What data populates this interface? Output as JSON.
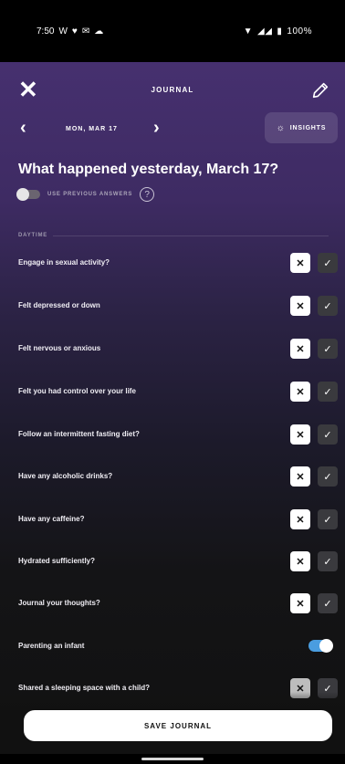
{
  "status_bar": {
    "time": "7:50",
    "left_icons": [
      "w-icon",
      "notification-icon",
      "mail-icon",
      "cloud-icon"
    ],
    "battery": "100%"
  },
  "header": {
    "title": "JOURNAL",
    "date": "MON, MAR 17",
    "insights_label": "INSIGHTS"
  },
  "main": {
    "headline": "What happened yesterday, March 17?",
    "use_previous_label": "USE PREVIOUS ANSWERS",
    "help_symbol": "?",
    "section_label": "DAYTIME",
    "questions": [
      {
        "text": "Engage in sexual activity?",
        "control": "yes-no"
      },
      {
        "text": "Felt depressed or down",
        "control": "yes-no"
      },
      {
        "text": "Felt nervous or anxious",
        "control": "yes-no"
      },
      {
        "text": "Felt you had control over your life",
        "control": "yes-no"
      },
      {
        "text": "Follow an intermittent fasting diet?",
        "control": "yes-no"
      },
      {
        "text": "Have any alcoholic drinks?",
        "control": "yes-no"
      },
      {
        "text": "Have any caffeine?",
        "control": "yes-no"
      },
      {
        "text": "Hydrated sufficiently?",
        "control": "yes-no"
      },
      {
        "text": "Journal your thoughts?",
        "control": "yes-no"
      },
      {
        "text": "Parenting an infant",
        "control": "toggle",
        "value": "on"
      },
      {
        "text": "Shared a sleeping space with a child?",
        "control": "yes-no"
      }
    ],
    "no_symbol": "✕",
    "yes_symbol": "✓"
  },
  "footer": {
    "save_label": "SAVE JOURNAL"
  },
  "colors": {
    "accent_toggle": "#4a9de0",
    "background_top": "#46306f",
    "background_bottom": "#111111"
  }
}
